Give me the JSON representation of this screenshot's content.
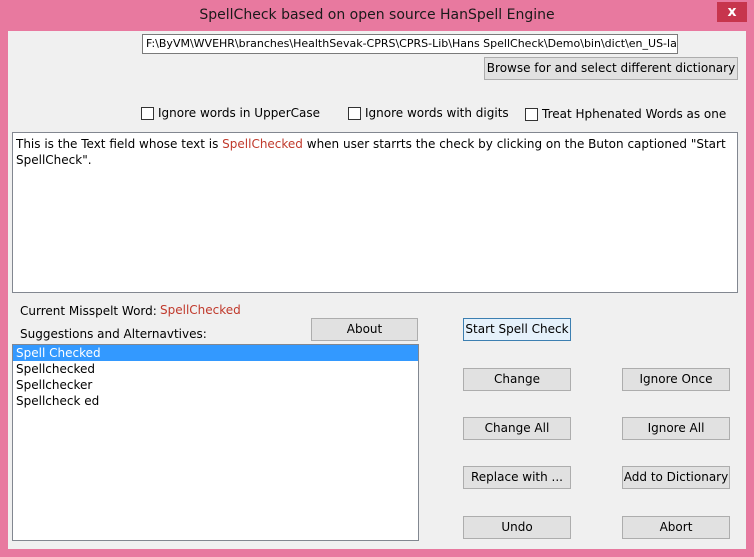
{
  "window": {
    "title": "SpellCheck based on open source HanSpell Engine",
    "close_glyph": "x"
  },
  "dictionary": {
    "path_value": "F:\\ByVM\\WVEHR\\branches\\HealthSevak-CPRS\\CPRS-Lib\\Hans SpellCheck\\Demo\\bin\\dict\\en_US-lar",
    "browse_button": "Browse for and select different dictionary"
  },
  "options": {
    "ignore_uppercase": {
      "label": "Ignore words in UpperCase",
      "checked": false
    },
    "ignore_digits": {
      "label": "Ignore words with digits",
      "checked": false
    },
    "treat_hyphenated": {
      "label": "Treat Hphenated Words as one",
      "checked": false
    }
  },
  "text_field": {
    "before": "This is the Text field whose text is ",
    "highlighted": "SpellChecked",
    "after": " when user starrts the check by clicking on the Buton captioned \"Start SpellCheck\"."
  },
  "misspelt": {
    "label": "Current Misspelt Word:",
    "word": "SpellChecked"
  },
  "suggestions": {
    "label": "Suggestions and Alternavtives:",
    "items": [
      "Spell Checked",
      "Spellchecked",
      "Spellchecker",
      "Spellcheck ed"
    ],
    "selected_index": 0
  },
  "buttons": {
    "about": "About",
    "start": "Start Spell Check",
    "change": "Change",
    "ignore_once": "Ignore Once",
    "change_all": "Change All",
    "ignore_all": "Ignore All",
    "replace_with": "Replace with ...",
    "add_to_dictionary": "Add to Dictionary",
    "undo": "Undo",
    "abort": "Abort"
  },
  "colors": {
    "frame_accent": "#e8799f",
    "misspelt_text": "#c0392b",
    "selection": "#3399ff"
  }
}
